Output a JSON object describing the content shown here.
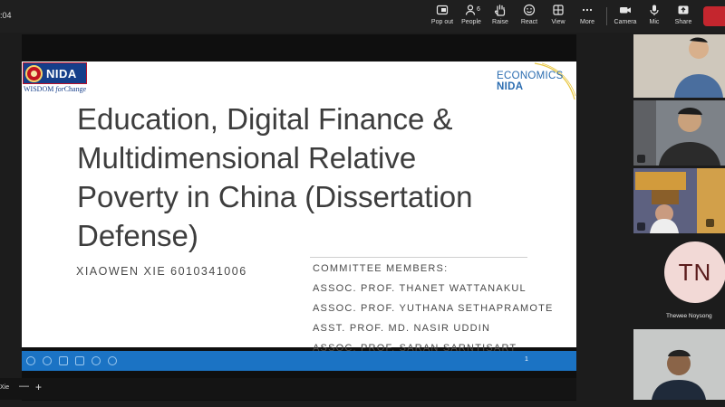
{
  "meeting": {
    "clock": ":04"
  },
  "toolbar": {
    "pop_out": "Pop out",
    "people": "People",
    "people_count": "6",
    "raise": "Raise",
    "react": "React",
    "view": "View",
    "more": "More",
    "camera": "Camera",
    "mic": "Mic",
    "share": "Share",
    "leave_color": "#c4262e"
  },
  "slide": {
    "logo_left": {
      "word": "NIDA",
      "tagline_a": "WISDOM",
      "tagline_b": "for",
      "tagline_c": "Change"
    },
    "logo_right": {
      "line1": "ECONOMICS",
      "line2": "NIDA"
    },
    "title_lines": [
      "Education, Digital Finance &",
      "Multidimensional Relative",
      "Poverty in China (Dissertation",
      "Defense)"
    ],
    "author": "XIAOWEN XIE 6010341006",
    "committee_header": "COMMITTEE MEMBERS:",
    "committee": [
      "ASSOC. PROF. THANET WATTANAKUL",
      "ASSOC. PROF. YUTHANA SETHAPRAMOTE",
      "ASST. PROF. MD. NASIR UDDIN",
      "ASSOC. PROF. SARAN SARNTISART"
    ],
    "page_number": "1",
    "control_bar_color": "#1b73c4"
  },
  "presenter": {
    "name_fragment": "Xie",
    "zoom_minus": "—",
    "zoom_plus": "+"
  },
  "gallery": {
    "tn_initials": "TN",
    "tn_name": "Thewee Noysong"
  }
}
